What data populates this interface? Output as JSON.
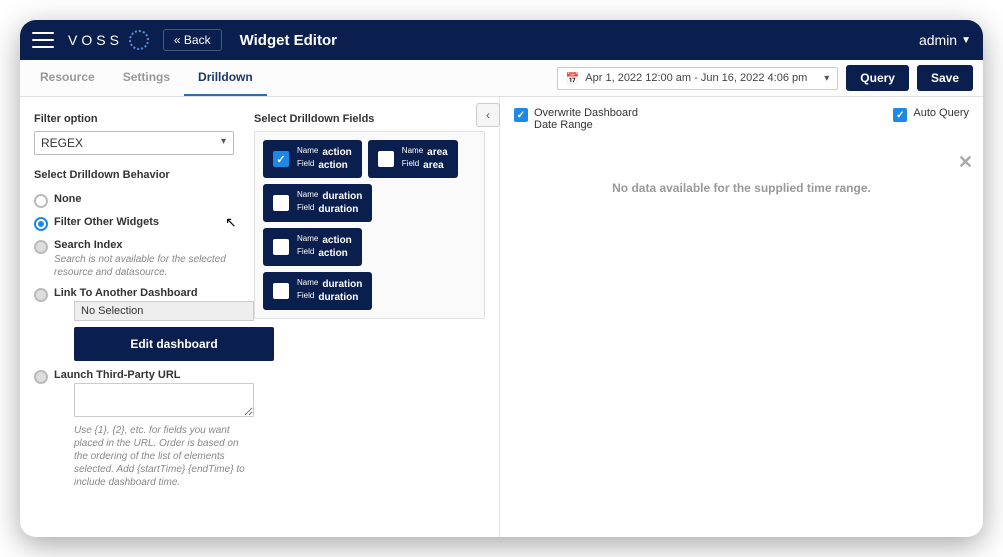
{
  "topbar": {
    "logo": "VOSS",
    "back": "« Back",
    "title": "Widget Editor",
    "user": "admin"
  },
  "tabs": [
    "Resource",
    "Settings",
    "Drilldown"
  ],
  "activeTab": 2,
  "dateRange": "Apr 1, 2022 12:00 am - Jun 16, 2022 4:06 pm",
  "buttons": {
    "query": "Query",
    "save": "Save"
  },
  "checks": {
    "overwrite": "Overwrite Dashboard Date Range",
    "autoQuery": "Auto Query"
  },
  "left": {
    "filterOptionLabel": "Filter option",
    "filterOption": "REGEX",
    "behaviorLabel": "Select Drilldown Behavior",
    "radios": {
      "none": "None",
      "filter": "Filter Other Widgets",
      "search": "Search Index",
      "searchHint": "Search is not available for the selected resource and datasource.",
      "link": "Link To Another Dashboard",
      "linkValue": "No Selection",
      "editDash": "Edit dashboard",
      "launch": "Launch Third-Party URL",
      "launchHint": "Use {1}, {2}, etc. for fields you want placed in the URL. Order is based on the ordering of the list of elements selected. Add {startTime} {endTime} to include dashboard time."
    }
  },
  "fieldsLabel": "Select Drilldown Fields",
  "fieldKeys": {
    "name": "Name",
    "field": "Field"
  },
  "fields": [
    {
      "name": "action",
      "field": "action",
      "checked": true
    },
    {
      "name": "area",
      "field": "area",
      "checked": false
    },
    {
      "name": "duration",
      "field": "duration",
      "checked": false
    },
    {
      "name": "action",
      "field": "action",
      "checked": false
    },
    {
      "name": "duration",
      "field": "duration",
      "checked": false
    }
  ],
  "noData": "No data available for the supplied time range."
}
